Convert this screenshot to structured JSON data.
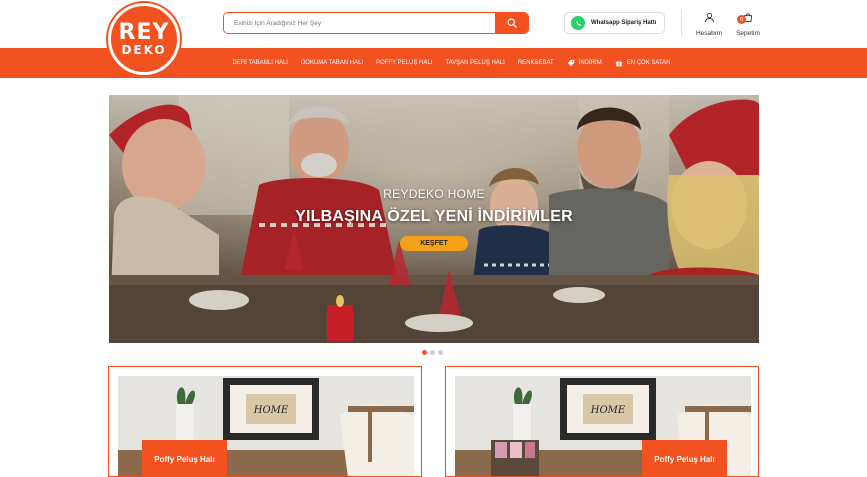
{
  "header": {
    "logo_top": "REY",
    "logo_bottom": "DEKO",
    "search_placeholder": "Evinizi İçin Aradığınız Her Şey",
    "whatsapp_label": "Whatsapp Sipariş Hattı",
    "account_label": "Hesabım",
    "cart_label": "Sepetim",
    "cart_count": "0"
  },
  "nav": {
    "items": [
      {
        "label": "DERİ TABANLI HALI"
      },
      {
        "label": "DOKUMA TABAN HALI"
      },
      {
        "label": "POFFY PELUŞ HALI"
      },
      {
        "label": "TAVŞAN PELUŞ HALI"
      },
      {
        "label": "RENK&EBAT"
      },
      {
        "label": "İNDİRİM",
        "icon": "tag-icon"
      },
      {
        "label": "EN ÇOK SATAN",
        "icon": "gift-icon"
      }
    ]
  },
  "hero": {
    "subtitle": "REYDEKO HOME",
    "title": "YILBAŞINA ÖZEL YENİ İNDİRİMLER",
    "button": "KEŞFET"
  },
  "slider": {
    "total": 3,
    "active": 1
  },
  "cards": [
    {
      "label": "Poffy Peluş Halı",
      "frame_text": "HOME"
    },
    {
      "label": "Poffy Peluş Halı",
      "frame_text": "HOME"
    }
  ],
  "colors": {
    "accent": "#f2521f",
    "button": "#f6a11a",
    "whatsapp": "#25d366"
  }
}
